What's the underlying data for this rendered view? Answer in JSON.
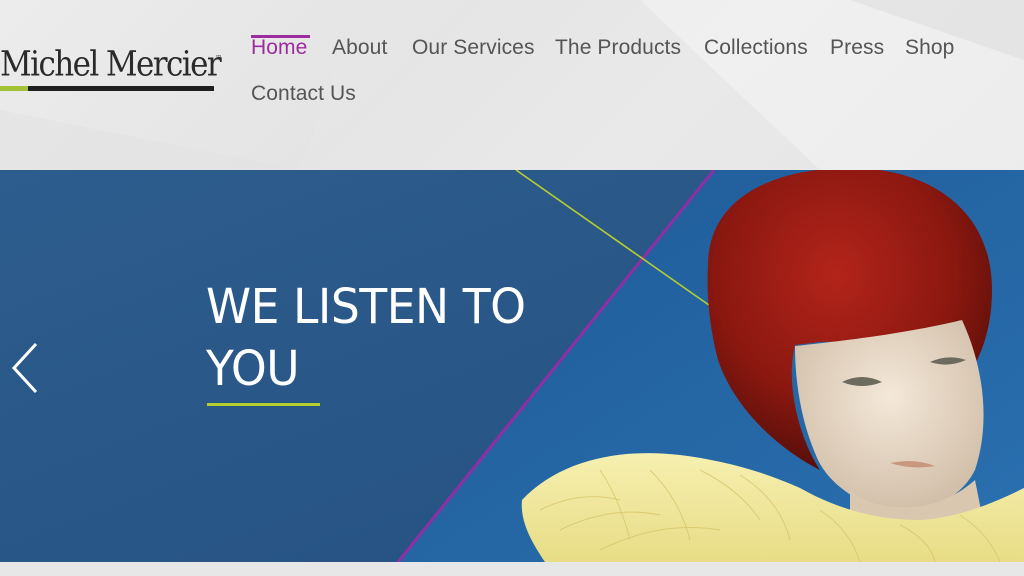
{
  "brand": {
    "name": "Michel Mercier",
    "trademark": "™",
    "accent_color": "#a3c238",
    "text_color": "#1f1f1f"
  },
  "nav": {
    "active_color": "#9c2d9e",
    "text_color": "#555555",
    "items": [
      {
        "label": "Home",
        "active": true
      },
      {
        "label": "About",
        "active": false
      },
      {
        "label": "Our Services",
        "active": false
      },
      {
        "label": "The Products",
        "active": false
      },
      {
        "label": "Collections",
        "active": false
      },
      {
        "label": "Press",
        "active": false
      },
      {
        "label": "Shop",
        "active": false
      },
      {
        "label": "Contact Us",
        "active": false
      }
    ]
  },
  "hero": {
    "headline": "WE LISTEN TO YOU",
    "background_color": "#2c5b8c",
    "underline_color": "#b7cf2e",
    "prev_arrow_icon": "chevron-left-icon"
  }
}
